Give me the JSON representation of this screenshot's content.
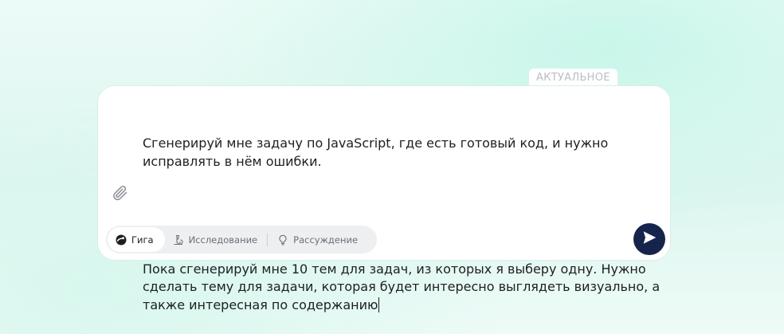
{
  "badge": {
    "label": "АКТУАЛЬНОЕ"
  },
  "prompt": {
    "paragraph_1": "Сгенерируй мне задачу по JavaScript, где есть готовый код, и нужно исправлять в нём ошибки.",
    "paragraph_2": "Пока сгенерируй мне 10 тем для задач, из которых я выберу одну. Нужно сделать тему для задачи, которая будет интересно выглядеть визуально, а также интересная по содержанию"
  },
  "attach": {
    "icon": "paperclip-icon"
  },
  "modes": [
    {
      "label": "Гига",
      "icon": "giga-logo-icon",
      "active": true
    },
    {
      "label": "Исследование",
      "icon": "research-icon",
      "active": false
    },
    {
      "label": "Рассуждение",
      "icon": "lightbulb-icon",
      "active": false
    }
  ],
  "send": {
    "icon": "send-arrow-icon",
    "color": "#16244d"
  }
}
